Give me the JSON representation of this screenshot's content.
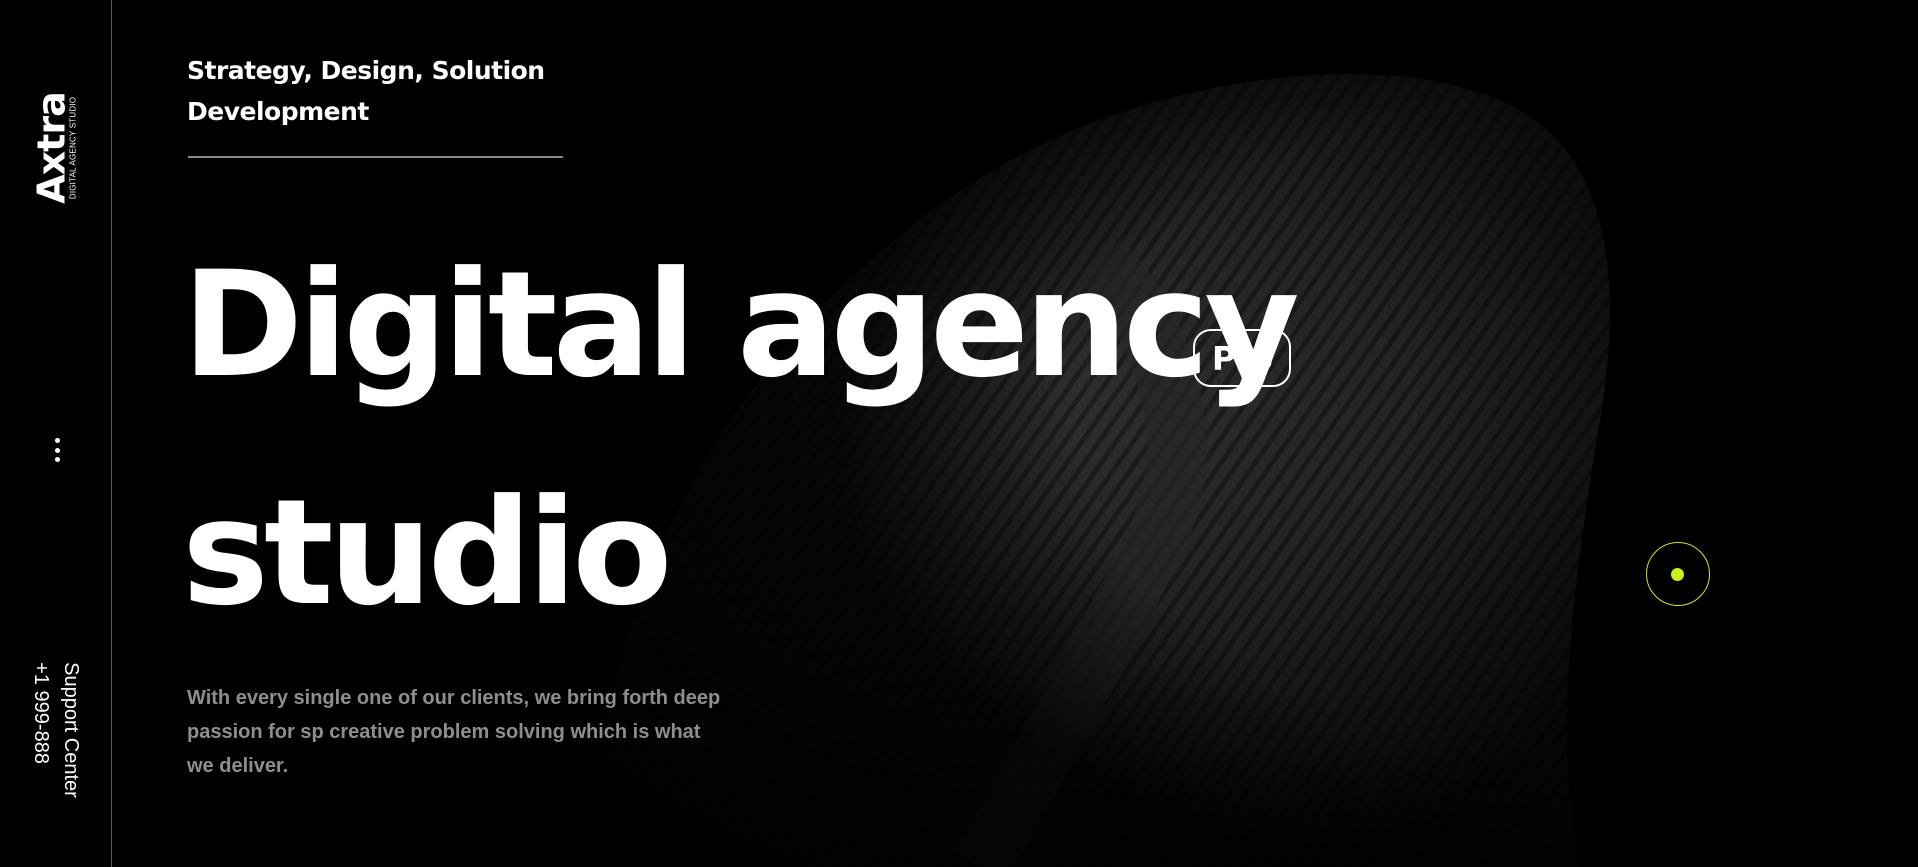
{
  "sidebar": {
    "logo_text": "Axtra",
    "logo_subtitle": "DIGITAL AGENCY STUDIO",
    "menu_icon": "more-dots-icon",
    "support_label": "Support Center",
    "support_phone": "+1 999-888"
  },
  "hero": {
    "tagline_line1": "Strategy, Design, Solution",
    "tagline_line2": "Development",
    "title_line1": "Digital agency",
    "title_line2": "studio",
    "badge": "Pro",
    "description": "With every single one of our clients, we bring forth deep passion for sp creative problem solving which is what we deliver."
  },
  "colors": {
    "background": "#000000",
    "text": "#ffffff",
    "muted_text": "#8e8e8e",
    "accent": "#c8f01e"
  }
}
